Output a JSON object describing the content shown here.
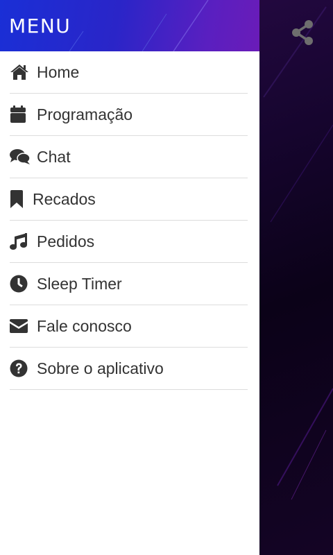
{
  "background": {
    "color": "#16052e",
    "accent": "#6a1cb8"
  },
  "header": {
    "title": "MENU",
    "color_start": "#1a2fd6",
    "color_end": "#6a1cb8"
  },
  "share": {
    "icon": "share-icon",
    "color": "#6e6e6e"
  },
  "menu": {
    "items": [
      {
        "label": "Home",
        "icon": "home-icon"
      },
      {
        "label": "Programação",
        "icon": "calendar-icon"
      },
      {
        "label": "Chat",
        "icon": "chat-icon"
      },
      {
        "label": "Recados",
        "icon": "bookmark-icon"
      },
      {
        "label": "Pedidos",
        "icon": "music-icon"
      },
      {
        "label": "Sleep Timer",
        "icon": "clock-icon"
      },
      {
        "label": "Fale conosco",
        "icon": "envelope-icon"
      },
      {
        "label": "Sobre o aplicativo",
        "icon": "question-icon"
      }
    ]
  }
}
